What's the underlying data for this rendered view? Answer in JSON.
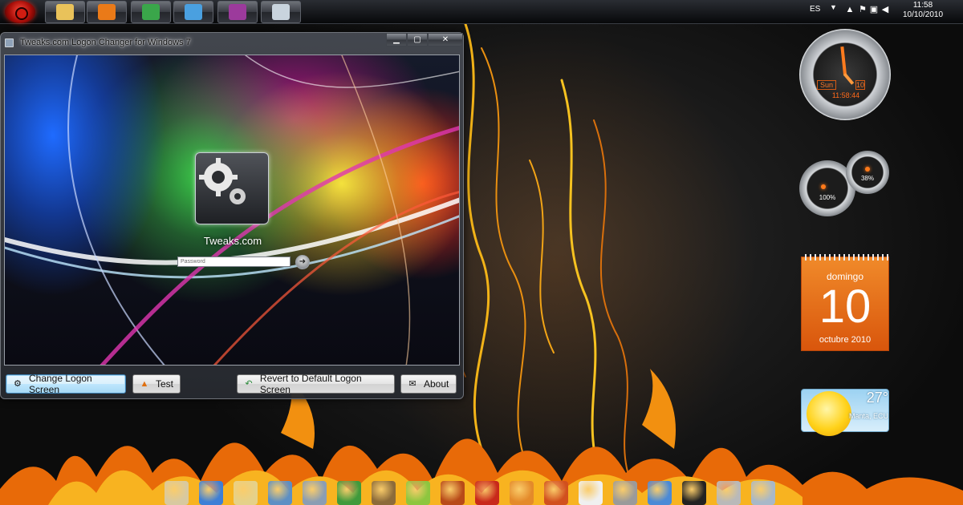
{
  "taskbar": {
    "apps": [
      {
        "name": "explorer-icon",
        "color": "#e9c25a"
      },
      {
        "name": "media-player-icon",
        "color": "#ea7a18"
      },
      {
        "name": "chrome-icon",
        "color": "#3aa64a"
      },
      {
        "name": "messenger-icon",
        "color": "#4aa0e0"
      },
      {
        "name": "winrar-icon",
        "color": "#9c3a9c"
      },
      {
        "name": "logon-changer-icon",
        "color": "#c9d4de"
      }
    ],
    "tray": {
      "language": "ES",
      "time": "11:58",
      "date": "10/10/2010"
    }
  },
  "window": {
    "title": "Tweaks.com Logon Changer for Windows 7",
    "preview": {
      "user_name": "Tweaks.com",
      "password_placeholder": "Password"
    },
    "buttons": {
      "change": "Change Logon Screen",
      "test": "Test",
      "revert": "Revert to Default Logon Screen",
      "about": "About"
    }
  },
  "gadgets": {
    "clock": {
      "day": "Sun",
      "date": "10",
      "time": "11:58:44"
    },
    "cpu_meter": {
      "cpu": "100%",
      "ram": "38%"
    },
    "calendar": {
      "weekday": "domingo",
      "day": "10",
      "month_year": "octubre 2010"
    },
    "weather": {
      "temperature": "27°",
      "location": "Manta, ECU"
    }
  },
  "dock": {
    "icons": [
      {
        "name": "notepad-icon",
        "color": "#d8c9a0"
      },
      {
        "name": "internet-explorer-icon",
        "color": "#3d7fd6"
      },
      {
        "name": "documents-folder-icon",
        "color": "#e5d18a"
      },
      {
        "name": "folder-icon",
        "color": "#5c8fc4"
      },
      {
        "name": "pictures-folder-icon",
        "color": "#8a9db3"
      },
      {
        "name": "messenger-dock-icon",
        "color": "#3f9a3c"
      },
      {
        "name": "ball-icon",
        "color": "#8c6b3a"
      },
      {
        "name": "lime-icon",
        "color": "#8dc63f"
      },
      {
        "name": "game-icon",
        "color": "#b84a18"
      },
      {
        "name": "opera-icon",
        "color": "#c8281a"
      },
      {
        "name": "app-icon",
        "color": "#e48a2a"
      },
      {
        "name": "firefox-icon",
        "color": "#d1501e"
      },
      {
        "name": "7zip-icon",
        "color": "#f0f0f0"
      },
      {
        "name": "tools-icon",
        "color": "#9a9a9a"
      },
      {
        "name": "network-icon",
        "color": "#4a8ad6"
      },
      {
        "name": "shirt-icon",
        "color": "#222222"
      },
      {
        "name": "settings-icon",
        "color": "#b9b9b9"
      },
      {
        "name": "recycle-bin-icon",
        "color": "#a8b8c8"
      }
    ]
  }
}
